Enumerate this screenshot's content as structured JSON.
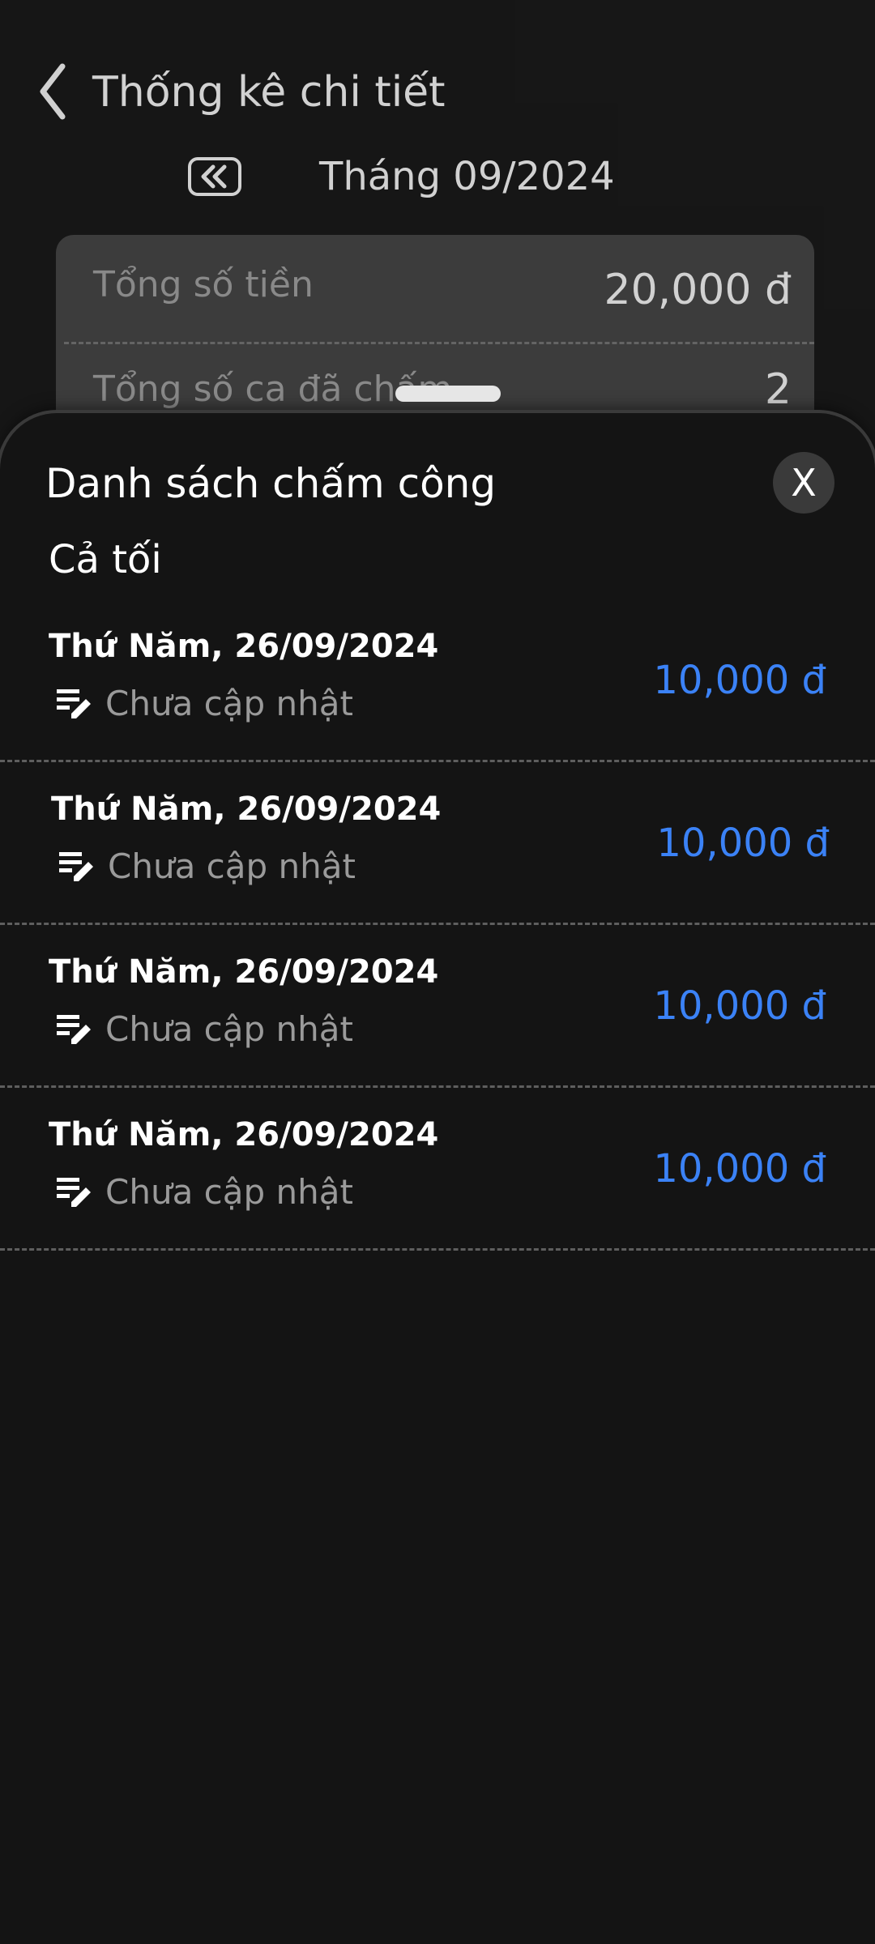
{
  "header": {
    "title": "Thống kê chi tiết",
    "back_icon": "chevron-left-icon"
  },
  "month_selector": {
    "prev_icon": "double-chevron-left-icon",
    "label": "Tháng 09/2024"
  },
  "summary": {
    "total_money_label": "Tổng số tiền",
    "total_money_value": "20,000 đ",
    "total_shifts_label": "Tổng số ca đã chấm",
    "total_shifts_value": "2"
  },
  "sheet": {
    "title": "Danh sách chấm công",
    "close_label": "X",
    "group_title": "Cả tối",
    "items": [
      {
        "date": "Thứ Năm, 26/09/2024",
        "note": "Chưa cập nhật",
        "amount": "10,000 đ"
      },
      {
        "date": "Thứ Năm, 26/09/2024",
        "note": "Chưa cập nhật",
        "amount": "10,000 đ"
      },
      {
        "date": "Thứ Năm, 26/09/2024",
        "note": "Chưa cập nhật",
        "amount": "10,000 đ"
      },
      {
        "date": "Thứ Năm, 26/09/2024",
        "note": "Chưa cập nhật",
        "amount": "10,000 đ"
      }
    ]
  },
  "colors": {
    "background": "#1c1c1c",
    "sheet": "#141414",
    "card": "#4a4a4a",
    "amount_accent": "#3b82f6",
    "muted_text": "#9a9a9a"
  }
}
